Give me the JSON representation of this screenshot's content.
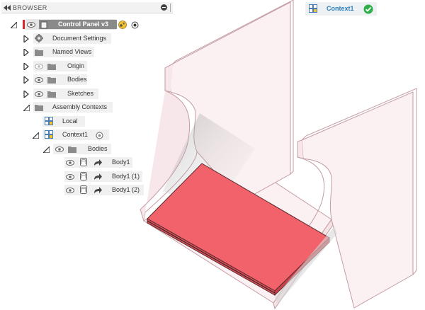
{
  "browser": {
    "title": "BROWSER",
    "root": {
      "label": "Control Panel v3"
    },
    "items": [
      {
        "label": "Document Settings"
      },
      {
        "label": "Named Views"
      },
      {
        "label": "Origin"
      },
      {
        "label": "Bodies"
      },
      {
        "label": "Sketches"
      },
      {
        "label": "Assembly Contexts"
      },
      {
        "label": "Local"
      },
      {
        "label": "Context1"
      },
      {
        "label": "Bodies"
      },
      {
        "label": "Body1"
      },
      {
        "label": "Body1 (1)"
      },
      {
        "label": "Body1 (2)"
      }
    ]
  },
  "context_indicator": {
    "label": "Context1",
    "status": "ok"
  },
  "colors": {
    "accent": "#2d7dba",
    "body_red": "#f2626a",
    "part_outline": "#c49ca3",
    "part_fill": "#fbf1f2",
    "status_green": "#2fae4a",
    "warning_yellow": "#f2c233"
  },
  "icons": {
    "collapse": "double-left-arrow-icon",
    "visibility": "eye-icon",
    "folder": "folder-icon",
    "settings": "gear-icon",
    "component": "component-icon",
    "context": "context-grid-icon",
    "body": "body-cylinder-icon",
    "link": "link-arrow-icon",
    "radio": "activate-radio-icon"
  }
}
